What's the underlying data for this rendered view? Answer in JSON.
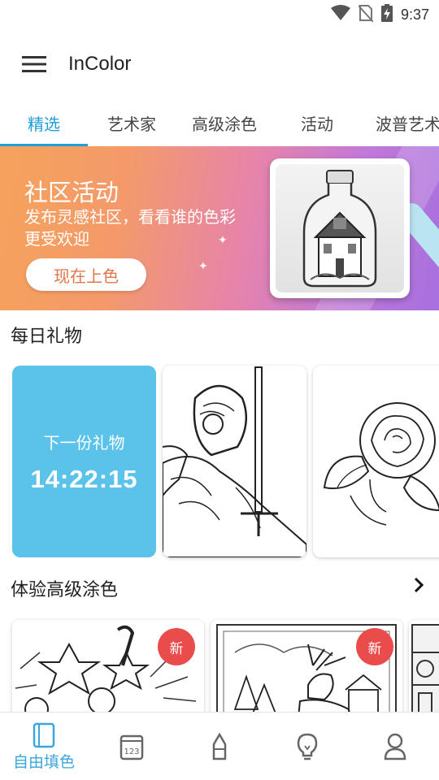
{
  "status_bar": {
    "time": "9:37"
  },
  "app_bar": {
    "title": "InColor"
  },
  "tabs": [
    {
      "label": "精选"
    },
    {
      "label": "艺术家"
    },
    {
      "label": "高级涂色"
    },
    {
      "label": "活动"
    },
    {
      "label": "波普艺术"
    }
  ],
  "banner": {
    "title": "社区活动",
    "subtitle": "发布灵感社区，看看谁的色彩更受欢迎",
    "button_label": "现在上色"
  },
  "daily_gift": {
    "title": "每日礼物",
    "next_gift_label": "下一份礼物",
    "countdown": "14:22:15"
  },
  "premium": {
    "title": "体验高级涂色",
    "badge": "新"
  },
  "bottom_nav": {
    "active_label": "自由填色",
    "accent": "#3aa6d9"
  },
  "colors": {
    "accent": "#1e9fd8",
    "gift_card": "#5bc3ea",
    "badge": "#ea4b4b"
  }
}
